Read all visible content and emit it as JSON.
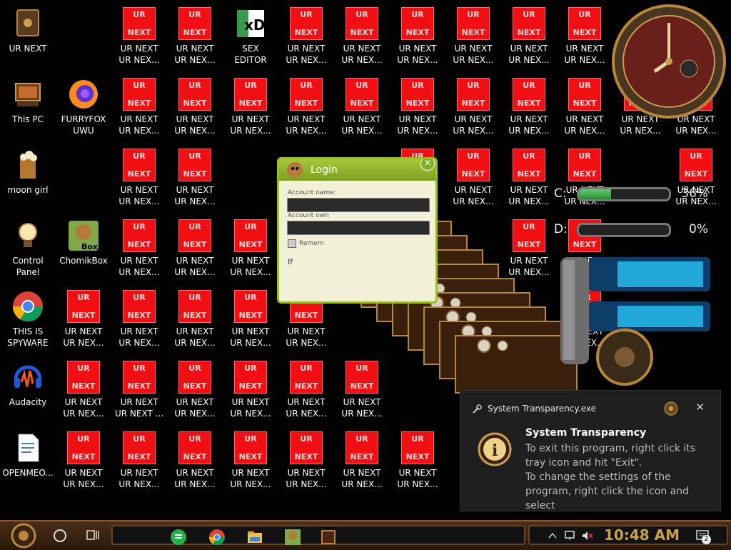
{
  "desktop": {
    "named_icons": [
      {
        "label": "UR NEXT",
        "icon": "steampunk-pc-icon"
      },
      {
        "label": "SEX\nEDITOR",
        "icon": "hxd-editor-icon"
      },
      {
        "label": "This PC",
        "icon": "steampunk-computer-icon"
      },
      {
        "label": "FURRYFOX\nUWU",
        "icon": "firefox-icon"
      },
      {
        "label": "moon girl",
        "icon": "popcorn-folder-icon"
      },
      {
        "label": "Control Panel",
        "icon": "lightbulb-icon"
      },
      {
        "label": "ChomikBox",
        "icon": "chomikbox-icon"
      },
      {
        "label": "THIS IS\nSPYWARE",
        "icon": "chrome-icon"
      },
      {
        "label": "Audacity",
        "icon": "audacity-icon"
      },
      {
        "label": "OPENMEO...",
        "icon": "document-icon"
      }
    ],
    "tile_top": "UR",
    "tile_bottom": "NEXT",
    "tile_label": "UR NEXT\nUR NEX...",
    "tile_label_alt": "UR NEXT\nUR NEXT ..."
  },
  "gadgets": {
    "drives": [
      {
        "letter": "C:",
        "percent_text": "36%",
        "percent": 36
      },
      {
        "letter": "D:",
        "percent_text": "0%",
        "percent": 0
      }
    ]
  },
  "login": {
    "title": "Login",
    "account_name_label": "Account name:",
    "account_label": "Account own",
    "remember_label": "Remem",
    "if_text": "If"
  },
  "notification": {
    "app_name": "System Transparency.exe",
    "close": "✕",
    "heading": "System Transparency",
    "body": "To exit this program, right click its tray icon and hit \"Exit\".\nTo change the settings of the program, right click the icon and select"
  },
  "taskbar": {
    "time": "10:48 AM",
    "notification_count": "2",
    "apps": [
      "sheets-icon",
      "chrome-icon",
      "file-explorer-icon",
      "chomikbox-icon",
      "steampunk-app-icon"
    ]
  },
  "colors": {
    "tile_red": "#f20f14",
    "login_green": "#9bbb2a",
    "taskbar_brown": "#4a2e18",
    "clock_gold": "#c8a04a"
  }
}
